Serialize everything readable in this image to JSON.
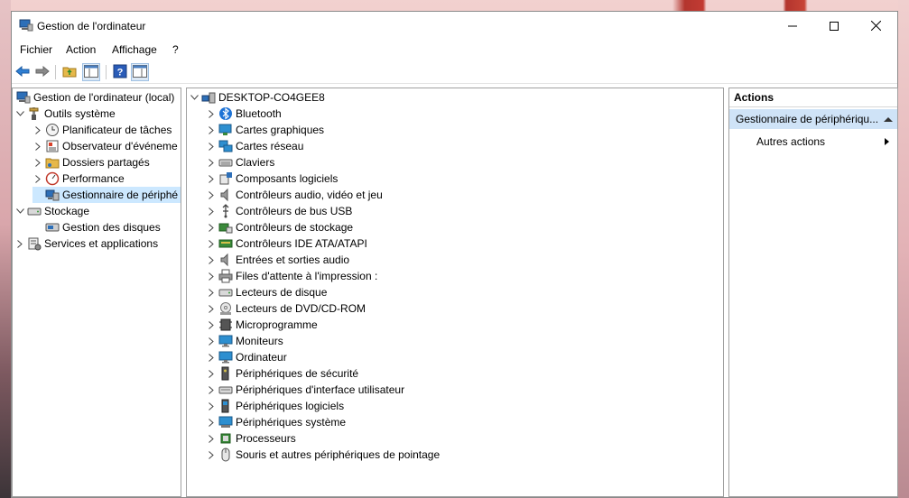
{
  "window": {
    "title": "Gestion de l'ordinateur"
  },
  "menu": [
    "Fichier",
    "Action",
    "Affichage",
    "?"
  ],
  "left_tree": [
    {
      "label": "Gestion de l'ordinateur (local)",
      "icon": "computer-management-icon",
      "level": 0
    },
    {
      "label": "Outils système",
      "icon": "tools-icon",
      "level": 1,
      "expanded": true
    },
    {
      "label": "Planificateur de tâches",
      "icon": "clock-icon",
      "level": 2
    },
    {
      "label": "Observateur d'événeme",
      "icon": "event-viewer-icon",
      "level": 2
    },
    {
      "label": "Dossiers partagés",
      "icon": "shared-folder-icon",
      "level": 2
    },
    {
      "label": "Performance",
      "icon": "performance-icon",
      "level": 2
    },
    {
      "label": "Gestionnaire de périphé",
      "icon": "device-manager-icon",
      "level": 2,
      "selected": true
    },
    {
      "label": "Stockage",
      "icon": "storage-icon",
      "level": 1,
      "expanded": true
    },
    {
      "label": "Gestion des disques",
      "icon": "disk-management-icon",
      "level": 2
    },
    {
      "label": "Services et applications",
      "icon": "services-icon",
      "level": 1
    }
  ],
  "device_tree": {
    "root": "DESKTOP-CO4GEE8",
    "categories": [
      "Bluetooth",
      "Cartes graphiques",
      "Cartes réseau",
      "Claviers",
      "Composants logiciels",
      "Contrôleurs audio, vidéo et jeu",
      "Contrôleurs de bus USB",
      "Contrôleurs de stockage",
      "Contrôleurs IDE ATA/ATAPI",
      "Entrées et sorties audio",
      "Files d'attente à l'impression :",
      "Lecteurs de disque",
      "Lecteurs de DVD/CD-ROM",
      "Microprogramme",
      "Moniteurs",
      "Ordinateur",
      "Périphériques de sécurité",
      "Périphériques d'interface utilisateur",
      "Périphériques logiciels",
      "Périphériques système",
      "Processeurs",
      "Souris et autres périphériques de pointage"
    ]
  },
  "actions": {
    "header": "Actions",
    "section": "Gestionnaire de périphériqu...",
    "more": "Autres actions"
  }
}
